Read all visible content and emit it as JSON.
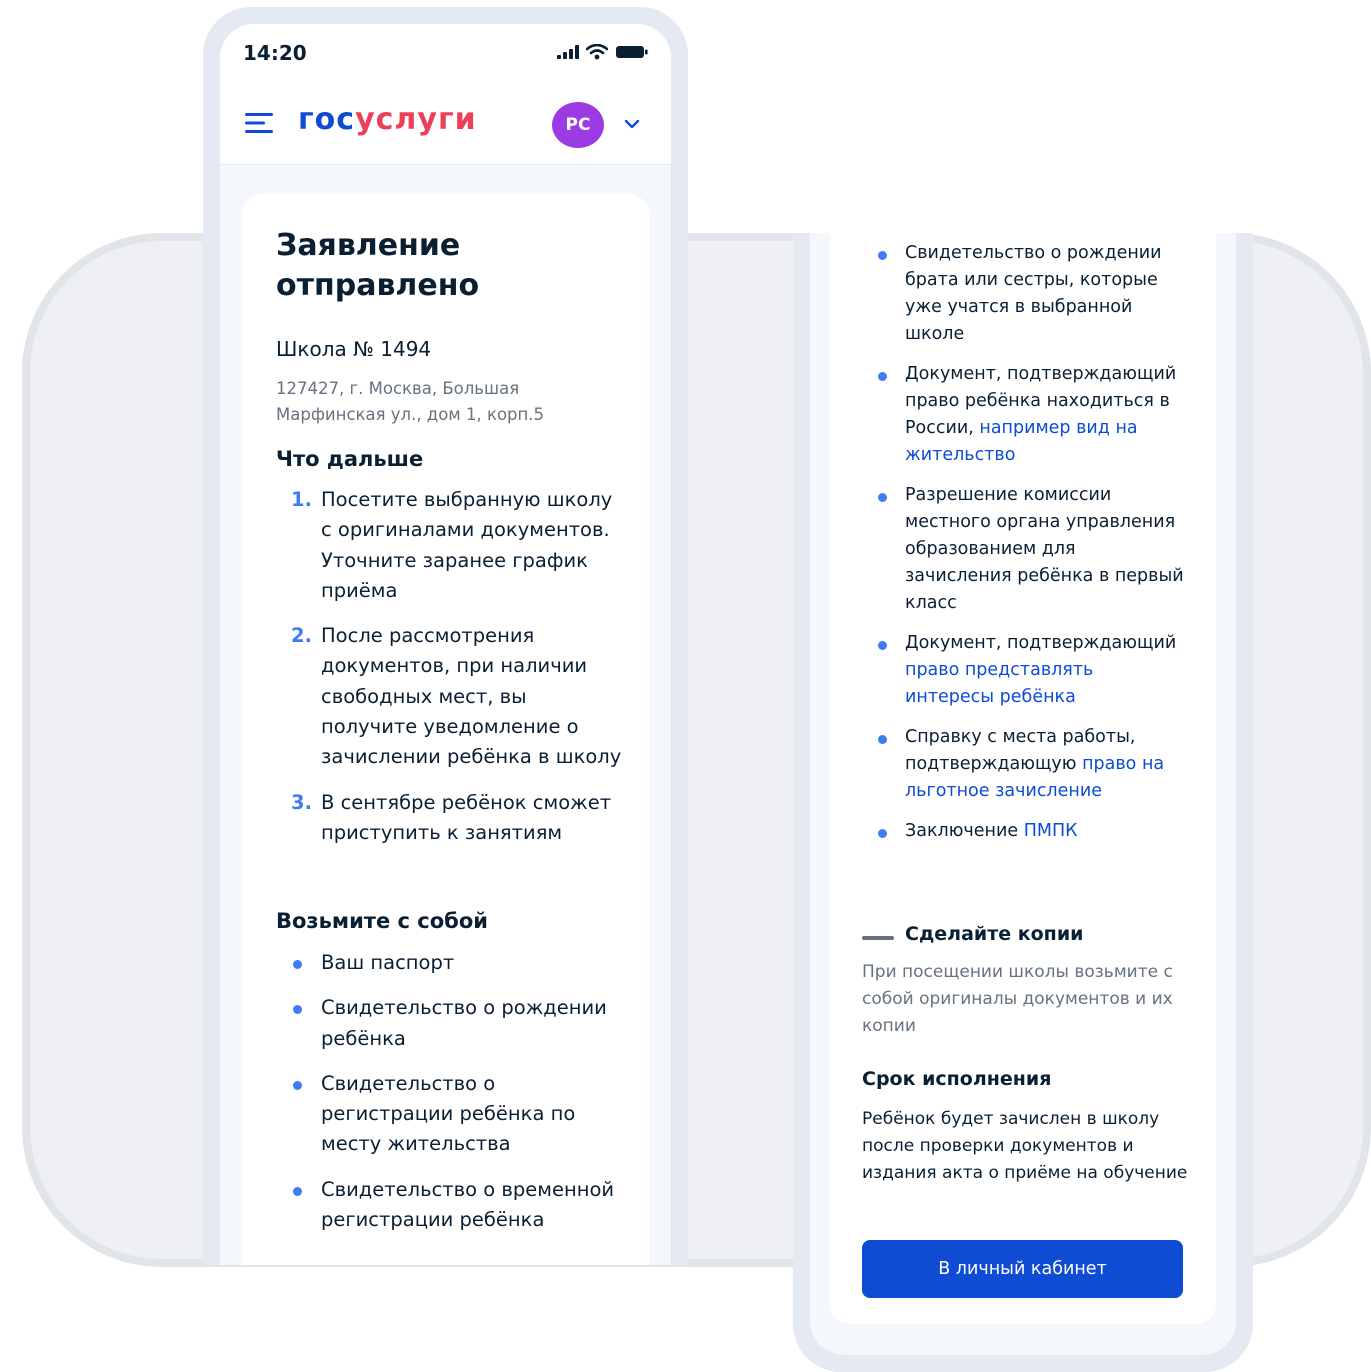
{
  "phone_left": {
    "status": {
      "time": "14:20"
    },
    "header": {
      "logo_part1": "гос",
      "logo_part2": "услуги",
      "avatar": "РС"
    },
    "title": "Заявление отправлено",
    "school": "Школа № 1494",
    "address": "127427, г. Москва, Большая Марфинская ул., дом 1, корп.5",
    "next_title": "Что дальше",
    "steps": [
      {
        "num": "1.",
        "text": "Посетите выбранную школу с оригиналами документов. Уточните заранее график приёма"
      },
      {
        "num": "2.",
        "text": "После рассмотрения документов, при наличии свободных мест, вы получите уведомление о зачислении ребёнка в школу"
      },
      {
        "num": "3.",
        "text": "В сентябре ребёнок сможет приступить к занятиям"
      }
    ],
    "take_title": "Возьмите с собой",
    "docs": [
      "Ваш паспорт",
      "Свидетельство о рождении ребёнка",
      "Свидетельство о регистрации ребёнка по месту жительства",
      "Свидетельство о временной регистрации ребёнка"
    ]
  },
  "phone_right": {
    "docs": [
      {
        "text": "Свидетельство о рождении брата или сестры, которые уже учатся в выбранной школе",
        "link": ""
      },
      {
        "text": "Документ, подтверждающий право ребёнка находиться в России, ",
        "link": "например вид на жительство"
      },
      {
        "text": "Разрешение комиссии местного органа управления образованием для зачисления ребёнка в первый класс",
        "link": ""
      },
      {
        "text": "Документ, подтверждающий ",
        "link": "право представлять интересы ребёнка"
      },
      {
        "text": "Справку с места работы, подтверждающую ",
        "link": "право на льготное зачисление"
      },
      {
        "text": "Заключение ",
        "link": "ПМПК"
      }
    ],
    "copies_title": "Сделайте копии",
    "copies_text": "При посещении школы возьмите с собой оригиналы документов и их копии",
    "term_title": "Срок исполнения",
    "term_text": "Ребёнок будет зачислен в школу после проверки документов и издания акта о приёме на обучение",
    "button": "В личный кабинет"
  },
  "colors": {
    "primary": "#0d4cd3",
    "logo_red": "#ee3f58",
    "accent_blue": "#3d7cf5",
    "avatar": "#9c3ae3",
    "text": "#0b1f33",
    "muted": "#66727f"
  },
  "icons": [
    "menu-icon",
    "signal-icon",
    "wifi-icon",
    "battery-icon",
    "chevron-down-icon"
  ]
}
